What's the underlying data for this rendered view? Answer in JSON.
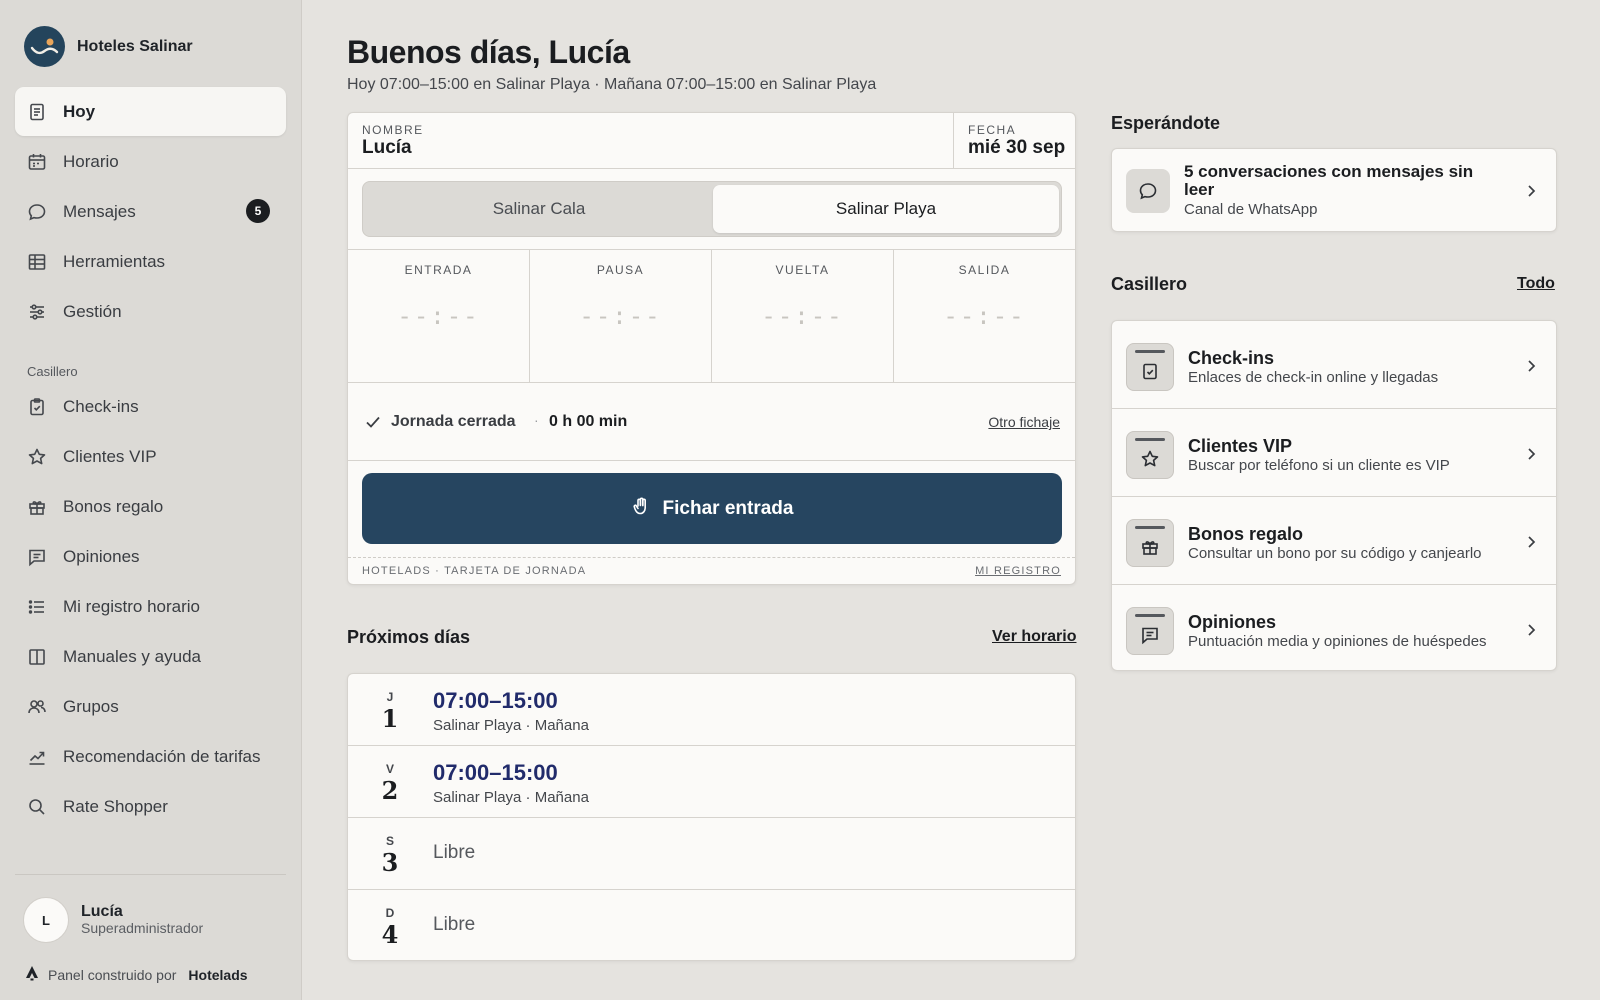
{
  "brand": {
    "name": "Hoteles Salinar",
    "color": "#24445c"
  },
  "sidebar": {
    "items": [
      {
        "label": "Hoy",
        "icon": "document-icon",
        "active": true
      },
      {
        "label": "Horario",
        "icon": "calendar-icon"
      },
      {
        "label": "Mensajes",
        "icon": "chat-bubble-icon",
        "badge": "5"
      },
      {
        "label": "Herramientas",
        "icon": "grid-table-icon"
      },
      {
        "label": "Gestión",
        "icon": "sliders-icon"
      }
    ],
    "section_label": "Casillero",
    "section_items": [
      {
        "label": "Check-ins",
        "icon": "clipboard-check-icon"
      },
      {
        "label": "Clientes VIP",
        "icon": "star-icon"
      },
      {
        "label": "Bonos regalo",
        "icon": "gift-icon"
      },
      {
        "label": "Opiniones",
        "icon": "message-square-icon"
      },
      {
        "label": "Mi registro horario",
        "icon": "list-icon"
      },
      {
        "label": "Manuales y ayuda",
        "icon": "book-icon"
      },
      {
        "label": "Grupos",
        "icon": "users-icon"
      },
      {
        "label": "Recomendación de tarifas",
        "icon": "trending-up-icon"
      },
      {
        "label": "Rate Shopper",
        "icon": "search-icon"
      }
    ],
    "user": {
      "initial": "L",
      "name": "Lucía",
      "role": "Superadministrador"
    },
    "powered_by": {
      "text": "Panel construido por",
      "brand": "Hotelads"
    }
  },
  "main": {
    "greeting": "Buenos días, Lucía",
    "subtitle": "Hoy 07:00–15:00 en Salinar Playa · Mañana 07:00–15:00 en Salinar Playa",
    "punch_card": {
      "name_label": "NOMBRE",
      "name_value": "Lucía",
      "date_label": "FECHA",
      "date_value": "mié 30 sep",
      "locations": [
        "Salinar Cala",
        "Salinar Playa"
      ],
      "selected_location": "Salinar Playa",
      "slots": [
        {
          "label": "ENTRADA",
          "value": "--:--"
        },
        {
          "label": "PAUSA",
          "value": "--:--"
        },
        {
          "label": "VUELTA",
          "value": "--:--"
        },
        {
          "label": "SALIDA",
          "value": "--:--"
        }
      ],
      "status_text": "Jornada cerrada",
      "duration": "0 h 00 min",
      "other_link": "Otro fichaje",
      "button_label": "Fichar entrada",
      "button_color": "#264560",
      "footer_left": "HOTELADS · TARJETA DE JORNADA",
      "footer_right": "MI REGISTRO"
    },
    "upcoming": {
      "title": "Próximos días",
      "link": "Ver horario",
      "days": [
        {
          "letter": "J",
          "num": "1",
          "time": "07:00–15:00",
          "detail": "Salinar Playa · Mañana"
        },
        {
          "letter": "V",
          "num": "2",
          "time": "07:00–15:00",
          "detail": "Salinar Playa · Mañana"
        },
        {
          "letter": "S",
          "num": "3",
          "free": "Libre"
        },
        {
          "letter": "D",
          "num": "4",
          "free": "Libre"
        }
      ]
    }
  },
  "right": {
    "waiting_title": "Esperándote",
    "waiting": {
      "title": "5 conversaciones con mensajes sin leer",
      "sub": "Canal de WhatsApp"
    },
    "locker_title": "Casillero",
    "locker_link": "Todo",
    "locker_items": [
      {
        "title": "Check-ins",
        "sub": "Enlaces de check-in online y llegadas",
        "icon": "clipboard-check-icon"
      },
      {
        "title": "Clientes VIP",
        "sub": "Buscar por teléfono si un cliente es VIP",
        "icon": "star-icon"
      },
      {
        "title": "Bonos regalo",
        "sub": "Consultar un bono por su código y canjearlo",
        "icon": "gift-icon"
      },
      {
        "title": "Opiniones",
        "sub": "Puntuación media y opiniones de huéspedes",
        "icon": "message-square-icon"
      }
    ]
  }
}
